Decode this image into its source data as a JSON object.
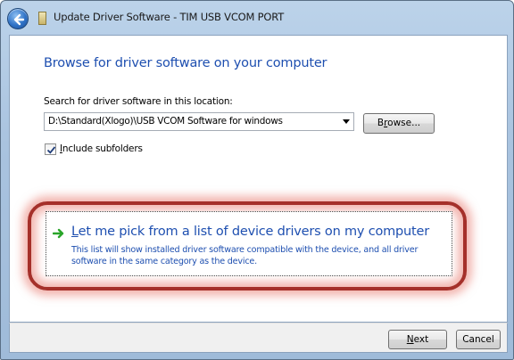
{
  "window": {
    "title": "Update Driver Software - TIM USB VCOM PORT"
  },
  "main": {
    "heading": "Browse for driver software on your computer",
    "search_label": "Search for driver software in this location:",
    "path_value": "D:\\Standard(Xlogo)\\USB VCOM Software for windows",
    "browse_label_pre": "B",
    "browse_label_mn": "r",
    "browse_label_post": "owse...",
    "include_subfolders": {
      "checked": true,
      "label_mn": "I",
      "label_rest": "nclude subfolders"
    },
    "pick_link": {
      "title_mn": "L",
      "title_rest": "et me pick from a list of device drivers on my computer",
      "description": "This list will show installed driver software compatible with the device, and all driver software in the same category as the device."
    }
  },
  "footer": {
    "next_mn": "N",
    "next_rest": "ext",
    "cancel_label": "Cancel"
  },
  "colors": {
    "link_blue": "#1e4fb0",
    "highlight_red": "#a5302a",
    "arrow_green": "#2aa52a"
  }
}
